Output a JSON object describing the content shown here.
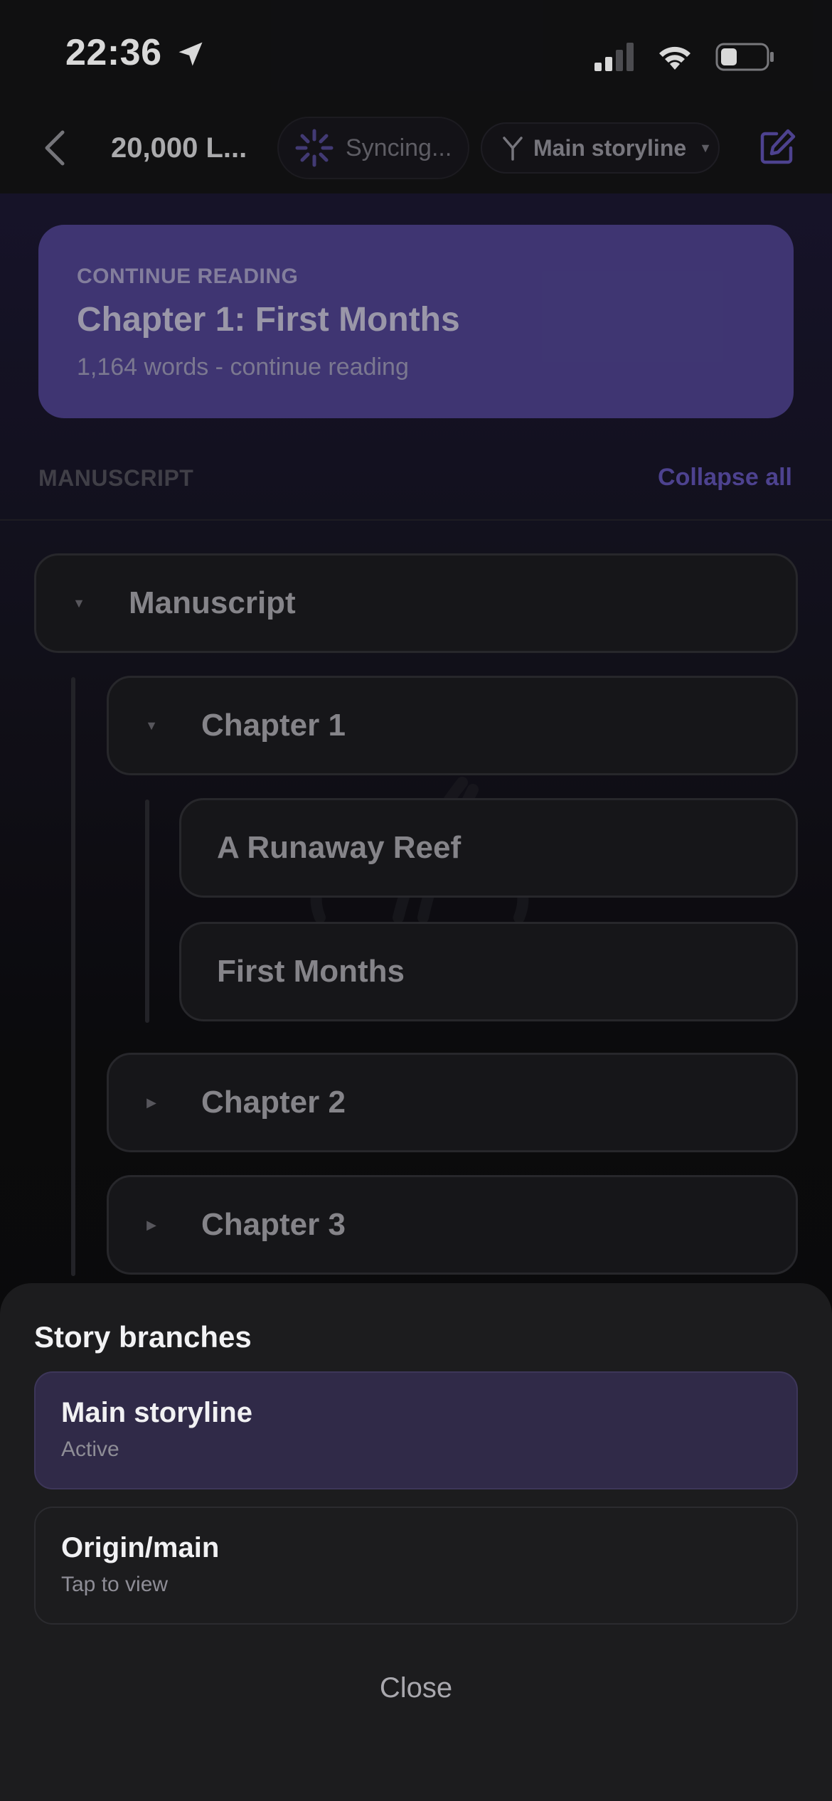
{
  "status_bar": {
    "time": "22:36"
  },
  "nav": {
    "book_title": "20,000 L...",
    "sync_label": "Syncing...",
    "branch_label": "Main storyline"
  },
  "continue_card": {
    "kicker": "CONTINUE READING",
    "title": "Chapter 1: First Months",
    "meta": "1,164 words - continue reading"
  },
  "manuscript_section": {
    "label": "MANUSCRIPT",
    "collapse_all": "Collapse all"
  },
  "tree": {
    "root": {
      "label": "Manuscript",
      "expanded": true
    },
    "chapter1": {
      "label": "Chapter 1",
      "expanded": true
    },
    "scene1": {
      "label": "A Runaway Reef"
    },
    "scene2": {
      "label": "First Months"
    },
    "chapter2": {
      "label": "Chapter 2",
      "expanded": false
    },
    "chapter3": {
      "label": "Chapter 3",
      "expanded": false
    }
  },
  "sheet": {
    "title": "Story branches",
    "branches": [
      {
        "name": "Main storyline",
        "status": "Active"
      },
      {
        "name": "Origin/main",
        "status": "Tap to view"
      }
    ],
    "close_label": "Close"
  },
  "colors": {
    "accent": "#4a3f86",
    "active_branch_bg": "#302a48",
    "sheet_bg": "#1c1c1e",
    "link": "#5b4ea8"
  }
}
